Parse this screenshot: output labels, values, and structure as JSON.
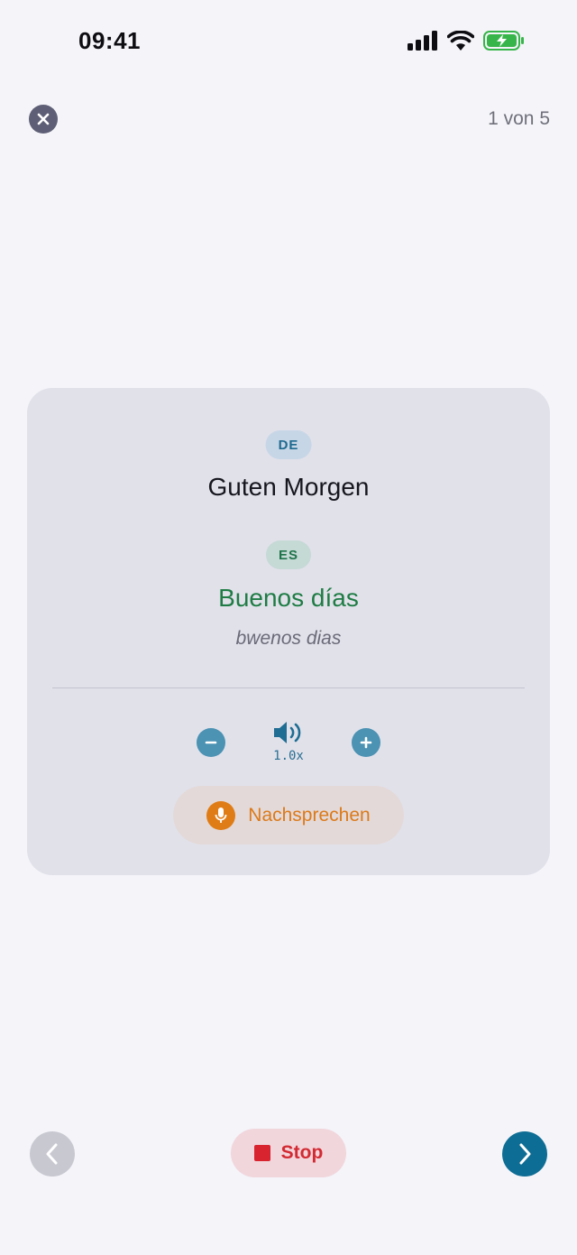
{
  "status_bar": {
    "time": "09:41",
    "icons": [
      "signal-icon",
      "wifi-icon",
      "battery-charging-icon"
    ]
  },
  "header": {
    "close_icon": "close-icon",
    "progress": "1 von 5"
  },
  "card": {
    "source_lang": "DE",
    "source_phrase": "Guten Morgen",
    "target_lang": "ES",
    "target_phrase": "Buenos días",
    "pronunciation": "bwenos dias",
    "speed_label": "1.0x",
    "repeat_label": "Nachsprechen"
  },
  "footer": {
    "stop_label": "Stop"
  },
  "colors": {
    "accent": "#0e6d94",
    "target_green": "#1e7c44",
    "mic_orange": "#e07c15",
    "stop_red": "#d8242f"
  }
}
